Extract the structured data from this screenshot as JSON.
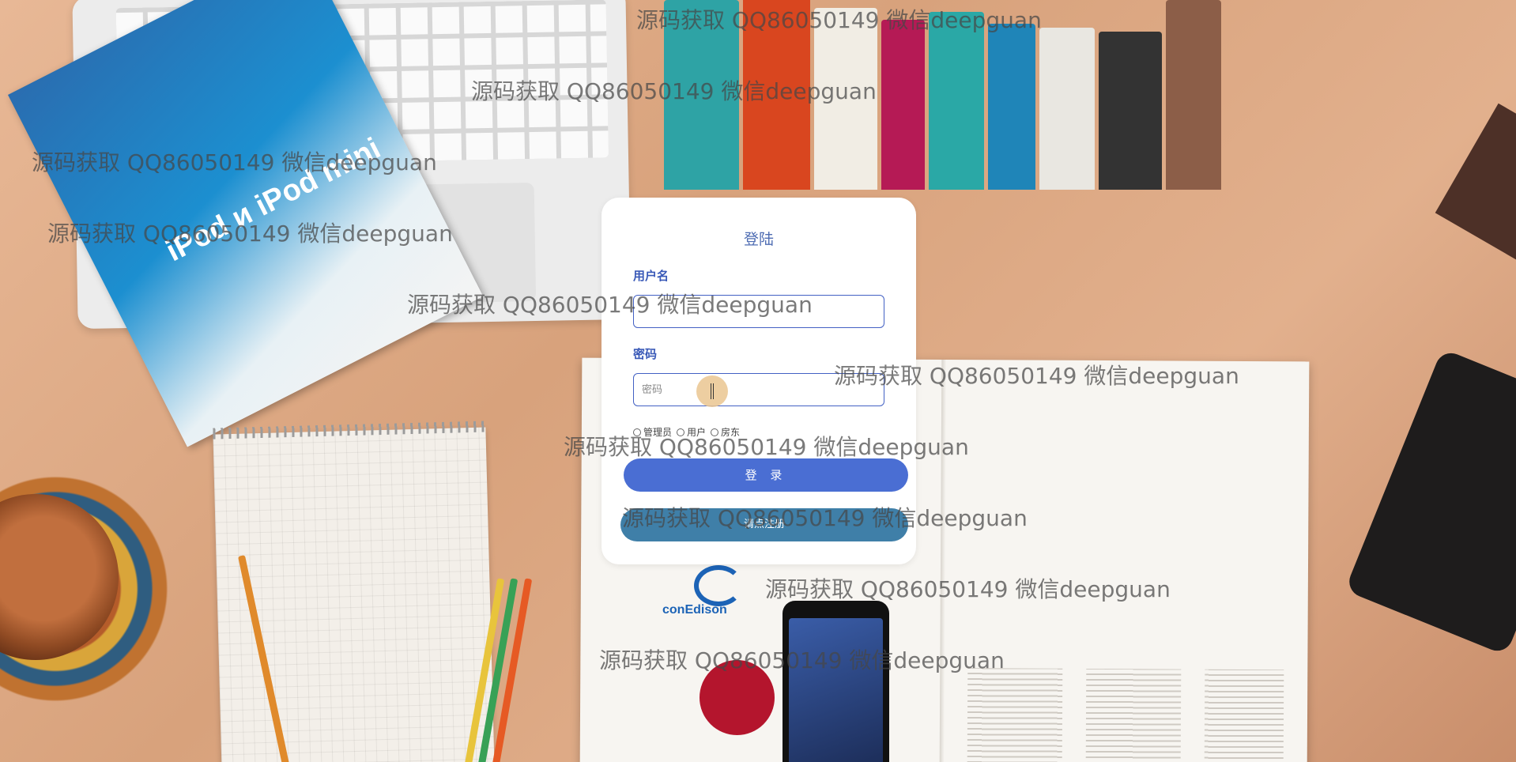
{
  "login": {
    "title": "登陆",
    "username_label": "用户名",
    "username_value": "",
    "username_placeholder": "",
    "password_label": "密码",
    "password_placeholder": "密码",
    "roles": [
      "管理员",
      "用户",
      "房东"
    ],
    "login_button": "登 录",
    "register_button": "请点注册"
  },
  "background": {
    "booklet_text": "iPod и iPod mini",
    "brand_text": "conEdison"
  },
  "watermark": {
    "text": "源码获取 QQ86050149 微信deepguan"
  },
  "colors": {
    "accent": "#4a6ed3",
    "label": "#3a5ab8",
    "register": "#3f7fa8"
  }
}
